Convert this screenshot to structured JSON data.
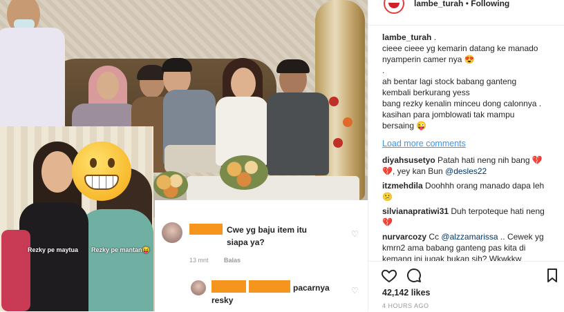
{
  "header": {
    "username": "lambe_turah",
    "separator": "•",
    "follow_status": "Following"
  },
  "caption": {
    "username": "lambe_turah",
    "suffix": ".",
    "lines": [
      "cieee cieee yg kemarin datang ke manado",
      "nyamperin camer nya 😍",
      ".",
      "ah bentar lagi stock babang ganteng",
      "kembali berkurang yess",
      "bang rezky kenalin minceu dong calonnya .",
      "kasihan para jomblowati tak mampu",
      "bersaing 😜"
    ]
  },
  "load_more": "Load more comments",
  "comments": [
    {
      "username": "diyahsusetyo",
      "text_a": "Patah hati neng nih bang",
      "emoji_a": "💔",
      "text_b": ", yey kan Bun",
      "mention": "@desles22",
      "emoji_b": "💔"
    },
    {
      "username": "itzmehdila",
      "text": "Doohhh orang manado dapa leh",
      "emoji": "😕"
    },
    {
      "username": "silvianapratiwi31",
      "text": "Duh terpoteque hati neng",
      "emoji": "💔"
    },
    {
      "username": "nurvarcozy",
      "text_a": "Cc",
      "mention": "@alzzamarissa",
      "text_b": ".. Cewek yg kmrn2 ama babang ganteng pas kita di kemang ini jugak bukan sih? Wkwkkw"
    }
  ],
  "likes": "42,142 likes",
  "time": "4 HOURS AGO",
  "icons": {
    "like": "heart-outline-icon",
    "comment": "comment-bubble-icon",
    "save": "bookmark-icon"
  },
  "photo": {
    "inset_tag_left": "Rezky pe maytua",
    "inset_tag_right": "Rezky pe mantan😝",
    "screenshot_comment_1": {
      "text": "Cwe yg baju item itu siapa ya?",
      "time": "13 mnt",
      "reply": "Balas"
    },
    "screenshot_comment_2": {
      "text": "pacarnya resky"
    }
  },
  "colors": {
    "link_blue": "#3897f0",
    "redaction_orange": "#f5951d",
    "text_dark": "#262626"
  }
}
